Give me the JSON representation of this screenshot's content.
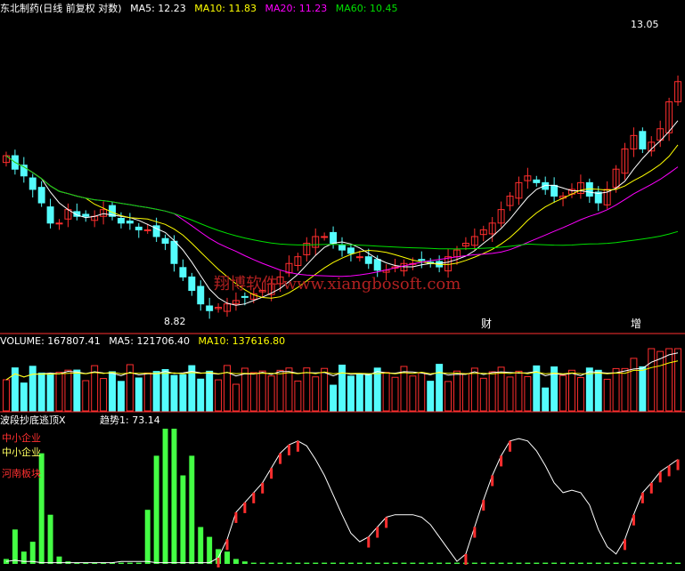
{
  "colors": {
    "background": "#000000",
    "up_candle": "#ff2e2e",
    "down_candle": "#54fcfc",
    "ma5": "#ffffff",
    "ma10": "#ffff00",
    "ma20": "#ff00ff",
    "ma60": "#00e000",
    "divider": "#ff3030",
    "volume_ma5": "#ffffff",
    "volume_ma10": "#ffff00",
    "trend_line": "#ffffff",
    "bottom_signal": "#44ff44"
  },
  "price_panel": {
    "title": "东北制药(日线 前复权 对数)",
    "ma5_label": "MA5: 12.23",
    "ma10_label": "MA10: 11.83",
    "ma20_label": "MA20: 11.23",
    "ma60_label": "MA60: 10.45",
    "high_marker": "13.05",
    "low_marker": "8.82",
    "watermark": "翔博软件 www.xiangbosoft.com",
    "event_labels": [
      "财",
      "增"
    ]
  },
  "volume_panel": {
    "volume_label": "VOLUME: 167807.41",
    "ma5_label": "MA5: 121706.40",
    "ma10_label": "MA10: 137616.80"
  },
  "indicator_panel": {
    "title": "波段抄底逃顶X",
    "trend_label": "趋势1: 73.14",
    "tags": [
      "中小企业",
      "中小企业",
      "河南板块"
    ]
  },
  "chart_data": [
    {
      "type": "candlestick",
      "title": "东北制药(日线 前复权 对数)",
      "series": [
        {
          "name": "MA5",
          "last": 12.23
        },
        {
          "name": "MA10",
          "last": 11.83
        },
        {
          "name": "MA20",
          "last": 11.23
        },
        {
          "name": "MA60",
          "last": 10.45
        }
      ],
      "annotations": [
        {
          "text": "13.05",
          "kind": "high"
        },
        {
          "text": "8.82",
          "kind": "low"
        }
      ],
      "ylim": [
        8.6,
        13.3
      ],
      "close": [
        11.2,
        11.0,
        10.9,
        10.7,
        10.5,
        10.2,
        10.2,
        10.4,
        10.3,
        10.3,
        10.3,
        10.4,
        10.3,
        10.2,
        10.2,
        10.1,
        10.1,
        10.0,
        9.9,
        9.6,
        9.4,
        9.2,
        9.0,
        8.9,
        8.95,
        9.0,
        9.05,
        9.1,
        9.15,
        9.2,
        9.3,
        9.4,
        9.6,
        9.7,
        9.9,
        10.0,
        10.0,
        9.9,
        9.8,
        9.75,
        9.7,
        9.6,
        9.5,
        9.5,
        9.55,
        9.6,
        9.6,
        9.65,
        9.6,
        9.55,
        9.7,
        9.8,
        9.9,
        10.0,
        10.1,
        10.2,
        10.4,
        10.6,
        10.8,
        10.9,
        10.8,
        10.7,
        10.6,
        10.6,
        10.7,
        10.8,
        10.6,
        10.5,
        10.7,
        11.0,
        11.3,
        11.5,
        11.3,
        11.4,
        11.6,
        12.0,
        12.3
      ]
    },
    {
      "type": "bar",
      "title": "VOLUME",
      "series": [
        {
          "name": "VOLUME",
          "last": 167807.41
        },
        {
          "name": "MA5",
          "last": 121706.4
        },
        {
          "name": "MA10",
          "last": 137616.8
        }
      ]
    },
    {
      "type": "line",
      "title": "波段抄底逃顶X",
      "series": [
        {
          "name": "趋势1",
          "last": 73.14
        }
      ],
      "trend": [
        2,
        3,
        2,
        2,
        1,
        1,
        1,
        1,
        1,
        1,
        1,
        1,
        1,
        2,
        2,
        2,
        2,
        1,
        1,
        1,
        1,
        1,
        1,
        1,
        5,
        20,
        42,
        50,
        58,
        66,
        78,
        90,
        97,
        100,
        96,
        85,
        72,
        56,
        40,
        25,
        18,
        22,
        30,
        38,
        40,
        40,
        40,
        38,
        32,
        22,
        12,
        2,
        8,
        30,
        52,
        72,
        88,
        100,
        102,
        100,
        92,
        80,
        66,
        58,
        60,
        58,
        48,
        28,
        14,
        8,
        20,
        40,
        58,
        66,
        75,
        80,
        85
      ],
      "ylim": [
        0,
        110
      ],
      "bottom_signal": [
        4,
        28,
        10,
        18,
        90,
        40,
        6,
        2,
        1,
        1,
        1,
        1,
        1,
        1,
        1,
        1,
        44,
        88,
        118,
        140,
        72,
        88,
        30,
        22,
        12,
        10,
        4,
        2,
        1,
        1,
        1,
        1,
        1,
        1,
        1,
        1,
        1,
        1,
        1,
        1,
        1,
        1,
        1,
        1,
        1,
        1,
        1,
        1,
        1,
        1,
        1,
        1,
        1,
        1,
        1,
        1,
        1,
        1,
        1,
        1,
        1,
        1,
        1,
        1,
        1,
        1,
        1,
        1,
        1,
        1,
        1,
        1,
        1,
        1,
        1,
        1,
        1
      ]
    }
  ]
}
